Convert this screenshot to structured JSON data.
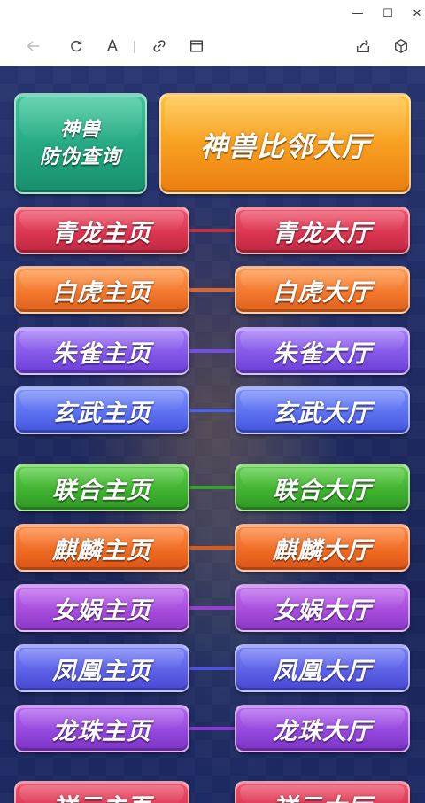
{
  "window": {
    "minimize_glyph": "—",
    "maximize_glyph": "☐",
    "close_glyph": "✕"
  },
  "toolbar": {
    "font_label": "A",
    "icons": [
      "back-arrow-icon",
      "refresh-icon",
      "font-icon",
      "link-icon",
      "window-icon",
      "share-icon",
      "cube-icon"
    ]
  },
  "header": {
    "verify_line1": "神兽",
    "verify_line2": "防伪查询",
    "neighbor_hall": "神兽比邻大厅"
  },
  "rows": [
    {
      "home": "青龙主页",
      "hall": "青龙大厅",
      "color": "#d9344f"
    },
    {
      "home": "白虎主页",
      "hall": "白虎大厅",
      "color": "#f2762b"
    },
    {
      "home": "朱雀主页",
      "hall": "朱雀大厅",
      "color": "#8255e8"
    },
    {
      "home": "玄武主页",
      "hall": "玄武大厅",
      "color": "#5a6ef0"
    },
    {
      "home": "联合主页",
      "hall": "联合大厅",
      "color": "#3fb12f"
    },
    {
      "home": "麒麟主页",
      "hall": "麒麟大厅",
      "color": "#ee6a22"
    },
    {
      "home": "女娲主页",
      "hall": "女娲大厅",
      "color": "#a44bdb"
    },
    {
      "home": "凤凰主页",
      "hall": "凤凰大厅",
      "color": "#5b5fe6"
    },
    {
      "home": "龙珠主页",
      "hall": "龙珠大厅",
      "color": "#9346dc"
    },
    {
      "home": "祥云主页",
      "hall": "祥云大厅",
      "color": "#d9344f"
    }
  ]
}
